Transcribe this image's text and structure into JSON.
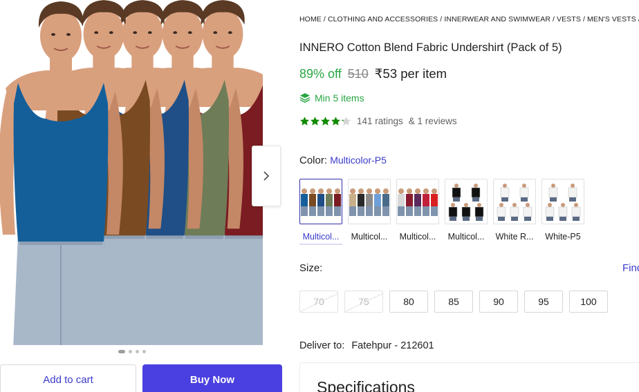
{
  "breadcrumb": [
    "HOME",
    "CLOTHING AND ACCESSORIES",
    "INNERWEAR AND SWIMWEAR",
    "VESTS",
    "MEN'S VESTS",
    "INNE"
  ],
  "product": {
    "title": "INNERO Cotton Blend Fabric Undershirt (Pack of 5)",
    "discount": "89% off",
    "mrp": "510",
    "price": "₹53 per item",
    "min_items": "Min 5 items",
    "rating_value": 4.2,
    "ratings_text": "141 ratings",
    "reviews_text": "& 1 reviews"
  },
  "gallery": {
    "dots": 4,
    "active_dot": 0,
    "vest_colors": [
      "#7a1c22",
      "#6f7c58",
      "#1f4f86",
      "#7a4b22",
      "#145f9a"
    ]
  },
  "buttons": {
    "add_to_cart": "Add to cart",
    "buy_now": "Buy Now"
  },
  "color": {
    "label": "Color:",
    "selected": "Multicolor-P5",
    "options": [
      {
        "label": "Multicol...",
        "selected": true,
        "vests": [
          "#145f9a",
          "#7a4b22",
          "#1f4f86",
          "#6f7c58",
          "#7a1c22"
        ]
      },
      {
        "label": "Multicol...",
        "selected": false,
        "vests": [
          "#c9b08a",
          "#2a2a2a",
          "#8a8a8a",
          "#6f9fd8",
          "#4a6a8a"
        ]
      },
      {
        "label": "Multicol...",
        "selected": false,
        "vests": [
          "#d8d8d8",
          "#8a1c30",
          "#5a2a5a",
          "#c0203a",
          "#d82020"
        ]
      },
      {
        "label": "Multicol...",
        "selected": false,
        "vests": [
          "#111111",
          "#111111",
          "#111111",
          "#111111",
          "#111111"
        ]
      },
      {
        "label": "White R...",
        "selected": false,
        "vests": [
          "#f4f4f4",
          "#f4f4f4",
          "#f4f4f4",
          "#f4f4f4",
          "#f4f4f4"
        ]
      },
      {
        "label": "White-P5",
        "selected": false,
        "vests": [
          "#f2f2f2",
          "#f2f2f2",
          "#f2f2f2",
          "#f2f2f2",
          "#f2f2f2"
        ]
      }
    ]
  },
  "size": {
    "label": "Size:",
    "chart_link": "Find",
    "options": [
      {
        "label": "70",
        "available": false
      },
      {
        "label": "75",
        "available": false
      },
      {
        "label": "80",
        "available": true
      },
      {
        "label": "85",
        "available": true
      },
      {
        "label": "90",
        "available": true
      },
      {
        "label": "95",
        "available": true
      },
      {
        "label": "100",
        "available": true
      }
    ]
  },
  "delivery": {
    "label": "Deliver to:",
    "location": "Fatehpur - 212601"
  },
  "specs": {
    "title": "Specifications"
  },
  "colors": {
    "accent": "#3a3aca",
    "buy_button": "#4a3fe0",
    "green": "#26a541"
  }
}
